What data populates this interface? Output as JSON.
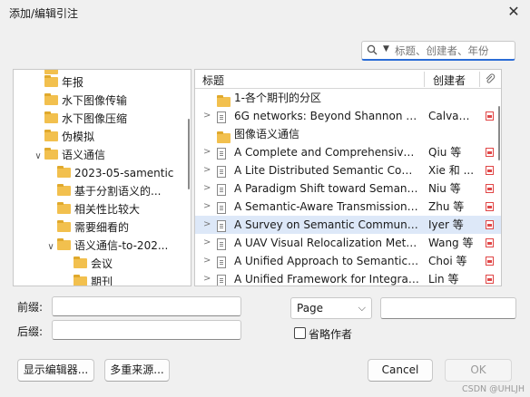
{
  "window": {
    "title": "添加/编辑引注",
    "close_glyph": "✕"
  },
  "search": {
    "placeholder": "标题、创建者、年份"
  },
  "tree": {
    "items": [
      {
        "label": "年报",
        "expanded": false
      },
      {
        "label": "水下图像传输",
        "expanded": false
      },
      {
        "label": "水下图像压缩",
        "expanded": false
      },
      {
        "label": "伪模拟",
        "expanded": false
      },
      {
        "label": "语义通信",
        "expanded": true,
        "chevron": "∨"
      },
      {
        "label": "2023-05-samentic",
        "expanded": false
      },
      {
        "label": "基于分割语义的...",
        "expanded": false
      },
      {
        "label": "相关性比较大",
        "expanded": false
      },
      {
        "label": "需要细看的",
        "expanded": false
      },
      {
        "label": "语义通信-to-202...",
        "expanded": true,
        "chevron": "∨"
      },
      {
        "label": "会议",
        "expanded": false
      },
      {
        "label": "期刊",
        "expanded": false
      }
    ]
  },
  "items_table": {
    "columns": {
      "title": "标题",
      "creator": "创建者",
      "attachment_icon": "paperclip-icon"
    },
    "rows": [
      {
        "type": "folder",
        "title": "1-各个期刊的分区",
        "creator": ""
      },
      {
        "type": "doc",
        "title": "6G networks: Beyond Shannon to...",
        "creator": "Calvan...",
        "pdf": true
      },
      {
        "type": "folder",
        "title": "图像语义通信",
        "creator": ""
      },
      {
        "type": "doc",
        "title": "A Complete and Comprehensive ...",
        "creator": "Qiu 等",
        "pdf": true
      },
      {
        "type": "doc",
        "title": "A Lite Distributed Semantic Com...",
        "creator": "Xie 和 ...",
        "pdf": true
      },
      {
        "type": "doc",
        "title": "A Paradigm Shift toward Semanti...",
        "creator": "Niu 等",
        "pdf": true
      },
      {
        "type": "doc",
        "title": "A Semantic-Aware Transmission ...",
        "creator": "Zhu 等",
        "pdf": true
      },
      {
        "type": "doc",
        "title": "A Survey on Semantic Communic...",
        "creator": "Iyer 等",
        "pdf": true,
        "selected": true
      },
      {
        "type": "doc",
        "title": "A UAV Visual Relocalization Meth...",
        "creator": "Wang 等",
        "pdf": true
      },
      {
        "type": "doc",
        "title": "A Unified Approach to Semantic I...",
        "creator": "Choi 等",
        "pdf": true
      },
      {
        "type": "doc",
        "title": "A Unified Framework for Integrati...",
        "creator": "Lin 等",
        "pdf": true
      }
    ]
  },
  "form": {
    "prefix_label": "前缀:",
    "suffix_label": "后缀:",
    "prefix_value": "",
    "suffix_value": "",
    "locator_selected": "Page",
    "locator_value": "",
    "omit_author_label": "省略作者",
    "omit_author_checked": false
  },
  "buttons": {
    "show_editor": "显示编辑器...",
    "multiple_sources": "多重来源...",
    "cancel": "Cancel",
    "ok": "OK"
  },
  "watermark": "CSDN @UHLJH"
}
